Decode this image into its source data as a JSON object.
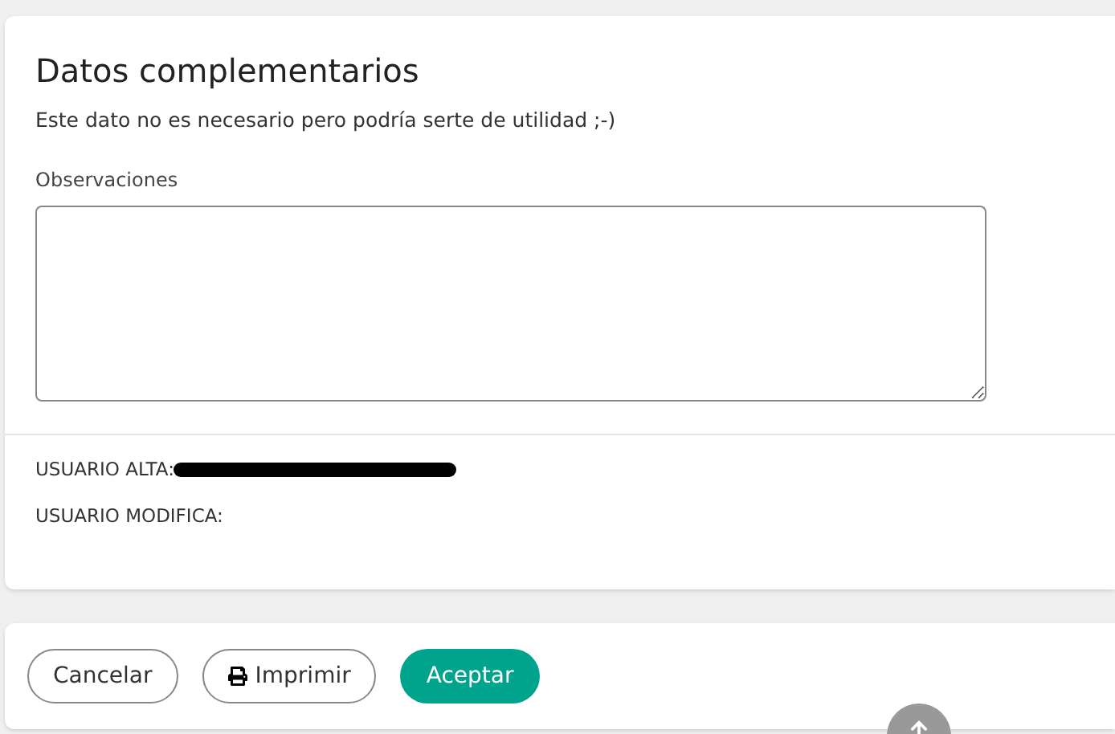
{
  "section": {
    "title": "Datos complementarios",
    "subtitle": "Este dato no es necesario pero podría serte de utilidad ;-)"
  },
  "observaciones": {
    "label": "Observaciones"
  },
  "audit": [
    {
      "label": "USUARIO ALTA:",
      "redacted": true
    },
    {
      "label": "USUARIO MODIFICA:",
      "redacted": false
    }
  ],
  "buttons": [
    {
      "label": "Cancelar",
      "kind": "outline"
    },
    {
      "label": "Imprimir",
      "kind": "print"
    },
    {
      "label": "Aceptar",
      "kind": "primary"
    }
  ]
}
